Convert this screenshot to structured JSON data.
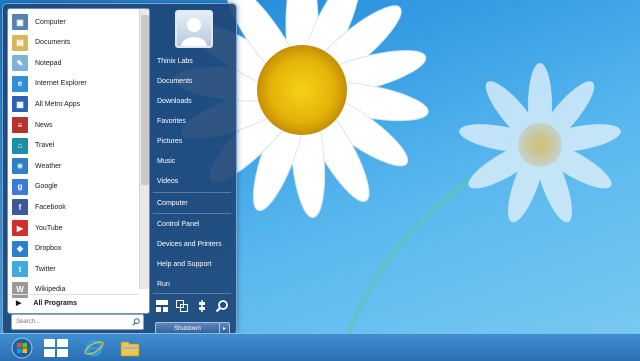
{
  "start_menu": {
    "programs": [
      {
        "label": "Computer",
        "icon": "computer-icon",
        "color": "#5a7fb3"
      },
      {
        "label": "Documents",
        "icon": "documents-icon",
        "color": "#d9b65a"
      },
      {
        "label": "Notepad",
        "icon": "notepad-icon",
        "color": "#7fb2d8"
      },
      {
        "label": "Internet Explorer",
        "icon": "internet-explorer-icon",
        "color": "#2f8fd8"
      },
      {
        "label": "All Metro Apps",
        "icon": "metro-apps-icon",
        "color": "#2b62b8"
      },
      {
        "label": "News",
        "icon": "news-icon",
        "color": "#b5322e"
      },
      {
        "label": "Travel",
        "icon": "travel-icon",
        "color": "#1e8fa8"
      },
      {
        "label": "Weather",
        "icon": "weather-icon",
        "color": "#2e7fc8"
      },
      {
        "label": "Google",
        "icon": "google-icon",
        "color": "#3c7ad9"
      },
      {
        "label": "Facebook",
        "icon": "facebook-icon",
        "color": "#3b5998"
      },
      {
        "label": "YouTube",
        "icon": "youtube-icon",
        "color": "#d12e2e"
      },
      {
        "label": "Dropbox",
        "icon": "dropbox-icon",
        "color": "#2a7fd4"
      },
      {
        "label": "Twitter",
        "icon": "twitter-icon",
        "color": "#3fa9e0"
      },
      {
        "label": "Wikipedia",
        "icon": "wikipedia-icon",
        "color": "#9a9a9a"
      }
    ],
    "all_programs": "All Programs",
    "search_placeholder": "Search...",
    "right_items": [
      {
        "label": "Thinix Labs"
      },
      {
        "label": "Documents"
      },
      {
        "label": "Downloads"
      },
      {
        "label": "Favorites"
      },
      {
        "label": "Pictures"
      },
      {
        "label": "Music"
      },
      {
        "label": "Videos"
      },
      {
        "label": "Computer"
      },
      {
        "label": "Control Panel"
      },
      {
        "label": "Devices and Printers"
      },
      {
        "label": "Help and Support"
      },
      {
        "label": "Run"
      }
    ],
    "shutdown_label": "Shutdown"
  },
  "taskbar": {
    "items": [
      "start-orb-icon",
      "metro-tiles-icon",
      "internet-explorer-icon",
      "file-explorer-icon"
    ]
  }
}
